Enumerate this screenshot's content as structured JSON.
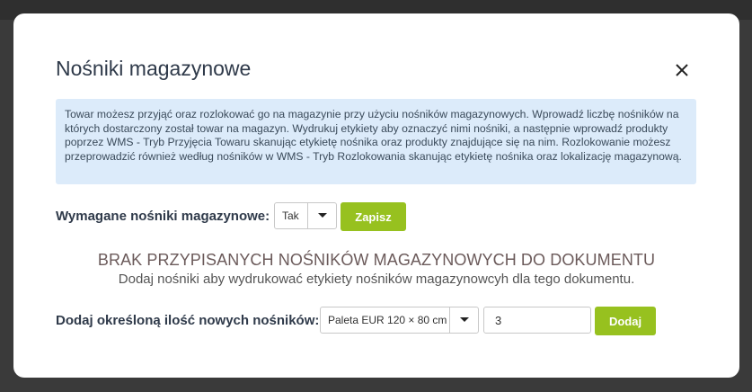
{
  "modal": {
    "title": "Nośniki magazynowe",
    "info_text": "Towar możesz przyjąć oraz rozlokować go na magazynie przy użyciu nośników magazynowych. Wprowadź liczbę nośników na których dostarczony został towar na magazyn. Wydrukuj etykiety aby oznaczyć nimi nośniki, a następnie wprowadź produkty poprzez WMS - Tryb Przyjęcia Towaru skanując etykietę nośnika oraz produkty znajdujące się na nim. Rozlokowanie możesz przeprowadzić również według nośników w WMS - Tryb Rozlokowania skanując etykietę nośnika oraz lokalizację magazynową."
  },
  "required": {
    "label": "Wymagane nośniki magazynowe:",
    "selected": "Tak",
    "save_label": "Zapisz"
  },
  "empty_state": {
    "title": "BRAK PRZYPISANYCH NOŚNIKÓW MAGAZYNOWYCH DO DOKUMENTU",
    "subtitle": "Dodaj nośniki aby wydrukować etykiety nośników magazynowcyh dla tego dokumentu."
  },
  "add": {
    "label": "Dodaj określoną ilość nowych nośników:",
    "type_selected": "Paleta EUR 120 × 80 cm",
    "quantity": "3",
    "add_label": "Dodaj"
  },
  "colors": {
    "accent": "#97c11f",
    "info_bg": "#dcebfa"
  }
}
